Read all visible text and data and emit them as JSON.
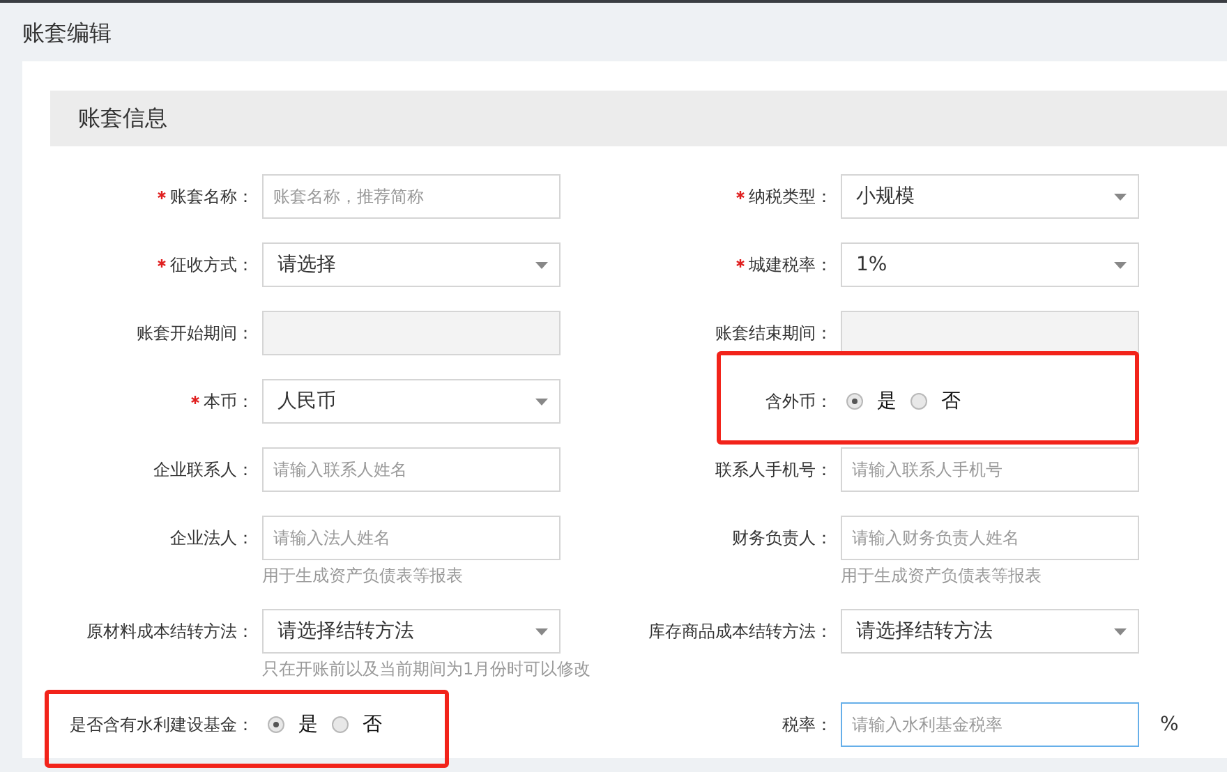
{
  "page_title": "账套编辑",
  "section": {
    "title": "账套信息"
  },
  "fields": [
    {
      "kind": "text",
      "label": "账套名称：",
      "required": true,
      "placeholder": "账套名称，推荐简称"
    },
    {
      "kind": "select",
      "label": "纳税类型：",
      "required": true,
      "value": "小规模"
    },
    {
      "kind": "select",
      "label": "征收方式：",
      "required": true,
      "value": "请选择"
    },
    {
      "kind": "select",
      "label": "城建税率：",
      "required": true,
      "value": "1%"
    },
    {
      "kind": "disabled",
      "label": "账套开始期间：",
      "required": false
    },
    {
      "kind": "disabled",
      "label": "账套结束期间：",
      "required": false
    },
    {
      "kind": "select",
      "label": "本币：",
      "required": true,
      "value": "人民币"
    },
    {
      "kind": "radio",
      "label": "含外币：",
      "required": false,
      "highlighted": true,
      "options": [
        {
          "label": "是",
          "selected": true
        },
        {
          "label": "否",
          "selected": false
        }
      ]
    },
    {
      "kind": "text",
      "label": "企业联系人：",
      "required": false,
      "placeholder": "请输入联系人姓名"
    },
    {
      "kind": "text",
      "label": "联系人手机号：",
      "required": false,
      "placeholder": "请输入联系人手机号"
    },
    {
      "kind": "text",
      "label": "企业法人：",
      "required": false,
      "placeholder": "请输入法人姓名",
      "hint": "用于生成资产负债表等报表"
    },
    {
      "kind": "text",
      "label": "财务负责人：",
      "required": false,
      "placeholder": "请输入财务负责人姓名",
      "hint": "用于生成资产负债表等报表"
    },
    {
      "kind": "select",
      "label": "原材料成本结转方法：",
      "required": false,
      "value": "请选择结转方法",
      "hint": "只在开账前以及当前期间为1月份时可以修改"
    },
    {
      "kind": "select",
      "label": "库存商品成本结转方法：",
      "required": false,
      "value": "请选择结转方法"
    },
    {
      "kind": "radio",
      "label": "是否含有水利建设基金：",
      "required": false,
      "highlighted": true,
      "options": [
        {
          "label": "是",
          "selected": true
        },
        {
          "label": "否",
          "selected": false
        }
      ]
    },
    {
      "kind": "text",
      "label": "税率：",
      "required": false,
      "placeholder": "请输入水利基金税率",
      "focused": true,
      "suffix": "%"
    }
  ]
}
